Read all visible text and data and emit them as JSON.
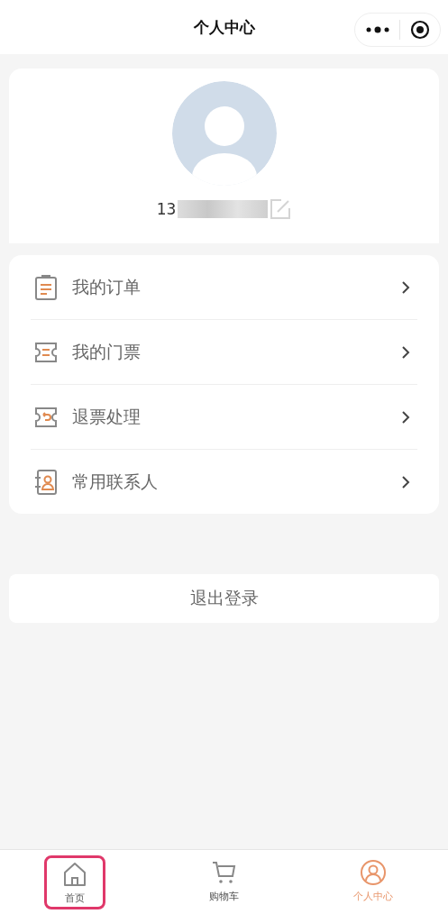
{
  "nav_bar": {
    "title": "个人中心"
  },
  "profile": {
    "phone_visible": "13",
    "phone_redacted": true
  },
  "menu": [
    {
      "kind": "order",
      "label": "我的订单"
    },
    {
      "kind": "ticket",
      "label": "我的门票"
    },
    {
      "kind": "refund",
      "label": "退票处理"
    },
    {
      "kind": "contact",
      "label": "常用联系人"
    }
  ],
  "logout_button": "退出登录",
  "tab_bar": [
    {
      "kind": "home",
      "label": "首页",
      "selected": false,
      "highlighted": true
    },
    {
      "kind": "cart",
      "label": "购物车",
      "selected": false,
      "highlighted": false
    },
    {
      "kind": "user",
      "label": "个人中心",
      "selected": true,
      "highlighted": false
    }
  ]
}
